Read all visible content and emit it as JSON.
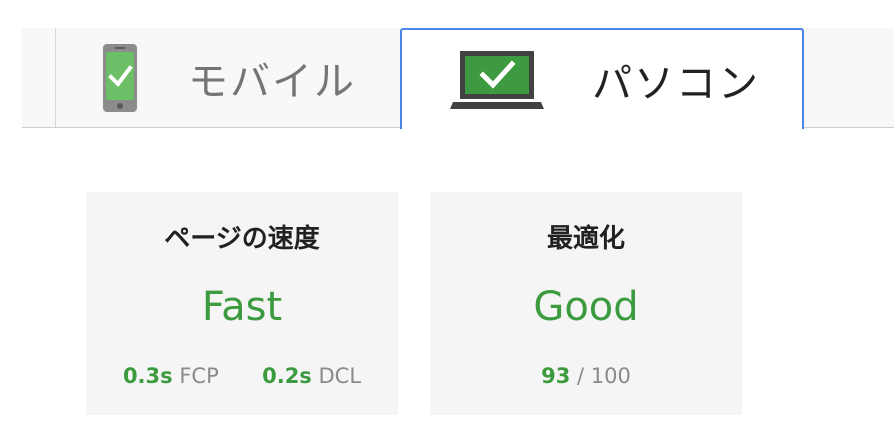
{
  "tabs": [
    {
      "label": "モバイル",
      "icon": "mobile-phone-icon",
      "selected": false
    },
    {
      "label": "パソコン",
      "icon": "laptop-icon",
      "selected": true
    }
  ],
  "cards": {
    "speed": {
      "title": "ページの速度",
      "value": "Fast",
      "metrics": [
        {
          "value": "0.3s",
          "label": "FCP"
        },
        {
          "value": "0.2s",
          "label": "DCL"
        }
      ]
    },
    "optimization": {
      "title": "最適化",
      "value": "Good",
      "score": "93",
      "score_max": "/ 100"
    }
  },
  "colors": {
    "good_green": "#3c9a3f",
    "tab_border": "#4a86e8",
    "card_bg": "#f5f5f5"
  }
}
